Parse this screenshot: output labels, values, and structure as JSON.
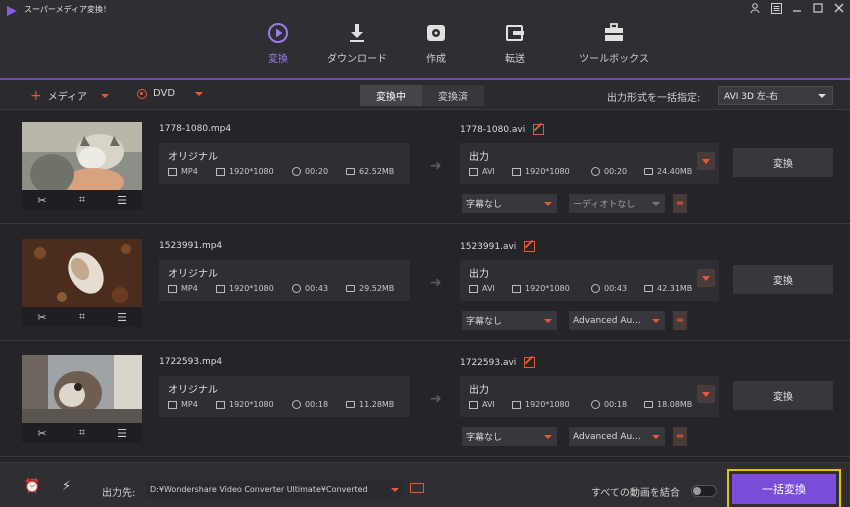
{
  "app": {
    "title": "スーパーメディア変換！",
    "window_controls": [
      "user-icon",
      "settings-icon",
      "minimize-icon",
      "maximize-icon",
      "close-icon"
    ]
  },
  "nav": {
    "accent": "#9b7be8",
    "items": [
      {
        "label": "変換",
        "icon": "convert-icon",
        "active": true
      },
      {
        "label": "ダウンロード",
        "icon": "download-icon",
        "active": false
      },
      {
        "label": "作成",
        "icon": "burn-disc-icon",
        "active": false
      },
      {
        "label": "転送",
        "icon": "transfer-icon",
        "active": false
      },
      {
        "label": "ツールボックス",
        "icon": "toolbox-icon",
        "active": false
      }
    ]
  },
  "toolbar": {
    "add_media_label": "メディア",
    "dvd_label": "DVD",
    "tabs": [
      {
        "label": "変換中",
        "active": true
      },
      {
        "label": "変換済",
        "active": false
      }
    ],
    "output_format_label": "出力形式を一括指定:",
    "output_format_value": "AVI 3D 左-右"
  },
  "items": [
    {
      "source": {
        "filename": "1778-1080.mp4",
        "title": "オリジナル",
        "format": "MP4",
        "resolution": "1920*1080",
        "duration": "00:20",
        "size": "62.52MB"
      },
      "output": {
        "filename": "1778-1080.avi",
        "title": "出力",
        "format": "AVI",
        "resolution": "1920*1080",
        "duration": "00:20",
        "size": "24.40MB"
      },
      "subtitle": "字幕なし",
      "audio": "ーディオトなし",
      "convert_label": "変換"
    },
    {
      "source": {
        "filename": "1523991.mp4",
        "title": "オリジナル",
        "format": "MP4",
        "resolution": "1920*1080",
        "duration": "00:43",
        "size": "29.52MB"
      },
      "output": {
        "filename": "1523991.avi",
        "title": "出力",
        "format": "AVI",
        "resolution": "1920*1080",
        "duration": "00:43",
        "size": "42.31MB"
      },
      "subtitle": "字幕なし",
      "audio": "Advanced Au...",
      "convert_label": "変換"
    },
    {
      "source": {
        "filename": "1722593.mp4",
        "title": "オリジナル",
        "format": "MP4",
        "resolution": "1920*1080",
        "duration": "00:18",
        "size": "11.28MB"
      },
      "output": {
        "filename": "1722593.avi",
        "title": "出力",
        "format": "AVI",
        "resolution": "1920*1080",
        "duration": "00:18",
        "size": "18.08MB"
      },
      "subtitle": "字幕なし",
      "audio": "Advanced Au...",
      "convert_label": "変換"
    }
  ],
  "bottom": {
    "output_label": "出力先:",
    "output_path": "D:¥Wondershare Video Converter Ultimate¥Converted",
    "merge_label": "すべての動画を結合",
    "merge_enabled": false,
    "convert_all_label": "一括変換",
    "convert_all_color": "#7a4dd8",
    "highlight_color": "#e8c200"
  }
}
